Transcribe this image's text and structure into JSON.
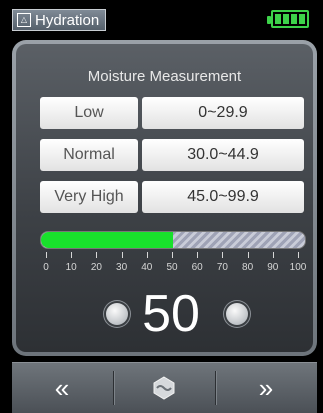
{
  "status": {
    "app_name": "Hydration",
    "app_icon": "app-icon",
    "battery_icon": "battery-full-icon",
    "battery_color": "#3dd24a"
  },
  "measurement": {
    "title": "Moisture Measurement",
    "ranges": [
      {
        "label": "Low",
        "range": "0~29.9"
      },
      {
        "label": "Normal",
        "range": "30.0~44.9"
      },
      {
        "label": "Very High",
        "range": "45.0~99.9"
      }
    ],
    "scale_labels": [
      "0",
      "10",
      "20",
      "30",
      "40",
      "50",
      "60",
      "70",
      "80",
      "90",
      "100"
    ],
    "level_percent": 50,
    "fill_color": "#19e12c",
    "value": "50"
  },
  "nav": {
    "back_symbol": "«",
    "forward_symbol": "»",
    "home_icon": "measure-icon"
  }
}
